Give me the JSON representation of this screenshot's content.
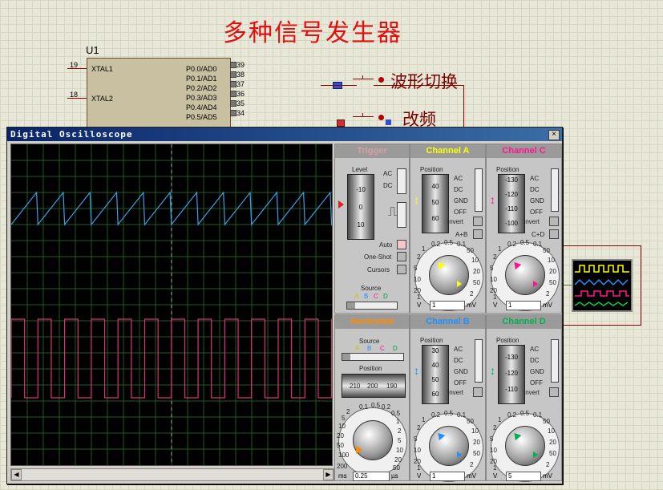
{
  "title": "多种信号发生器",
  "schematic": {
    "chip_ref": "U1",
    "pins_left": [
      {
        "num": "19",
        "name": "XTAL1"
      },
      {
        "num": "18",
        "name": "XTAL2"
      }
    ],
    "pins_right": [
      {
        "name": "P0.0/AD0",
        "num": "39"
      },
      {
        "name": "P0.1/AD1",
        "num": "38"
      },
      {
        "name": "P0.2/AD2",
        "num": "37"
      },
      {
        "name": "P0.3/AD3",
        "num": "36"
      },
      {
        "name": "P0.4/AD4",
        "num": "35"
      },
      {
        "name": "P0.5/AD5",
        "num": "34"
      }
    ],
    "button1_label": "波形切换",
    "button2_label": "改频"
  },
  "window": {
    "title": "Digital Oscilloscope",
    "close": "×"
  },
  "trigger": {
    "header": "Trigger",
    "level_label": "Level",
    "drum": [
      "-10",
      "0",
      "10"
    ],
    "ac": "AC",
    "dc": "DC",
    "auto": "Auto",
    "one_shot": "One-Shot",
    "cursors": "Cursors",
    "source_label": "Source",
    "sources": [
      "A",
      "B",
      "C",
      "D"
    ]
  },
  "channel_a": {
    "header": "Channel A",
    "position_label": "Position",
    "drum": [
      "40",
      "50",
      "60"
    ],
    "modes": [
      "AC",
      "DC",
      "GND",
      "OFF"
    ],
    "invert": "Invert",
    "combine": "A+B",
    "scale_left": [
      "1",
      "2",
      "5",
      "10",
      "20"
    ],
    "scale_right": [
      "10",
      "20",
      "50",
      "1",
      "2"
    ],
    "scale_top": [
      "0.2",
      "0.5"
    ],
    "scale_bot": [
      "0.1",
      "50"
    ],
    "unit_left": "V",
    "value": "1",
    "unit_right": "mV",
    "color": "#ffff00"
  },
  "channel_b": {
    "header": "Channel B",
    "position_label": "Position",
    "drum": [
      "30",
      "40",
      "50",
      "60"
    ],
    "modes": [
      "AC",
      "DC",
      "GND",
      "OFF"
    ],
    "invert": "Invert",
    "scale_left": [
      "1",
      "2",
      "5",
      "10",
      "20"
    ],
    "scale_right": [
      "10",
      "20",
      "50",
      "1",
      "2"
    ],
    "scale_top": [
      "0.2",
      "0.5"
    ],
    "scale_bot": [
      "0.1",
      "50"
    ],
    "unit_left": "V",
    "value": "1",
    "unit_right": "mV",
    "color": "#1e90ff"
  },
  "channel_c": {
    "header": "Channel C",
    "position_label": "Position",
    "drum": [
      "-130",
      "-120",
      "-110",
      "-100"
    ],
    "modes": [
      "AC",
      "DC",
      "GND",
      "OFF"
    ],
    "invert": "Invert",
    "combine": "C+D",
    "scale_left": [
      "1",
      "2",
      "5",
      "10",
      "20"
    ],
    "scale_right": [
      "10",
      "20",
      "50",
      "1",
      "2"
    ],
    "scale_top": [
      "0.2",
      "0.5"
    ],
    "scale_bot": [
      "0.1",
      "50"
    ],
    "unit_left": "V",
    "value": "1",
    "unit_right": "mV",
    "color": "#ff1493"
  },
  "channel_d": {
    "header": "Channel D",
    "position_label": "Position",
    "drum": [
      "-130",
      "-120",
      "-110"
    ],
    "modes": [
      "AC",
      "DC",
      "GND",
      "OFF"
    ],
    "invert": "Invert",
    "scale_left": [
      "1",
      "2",
      "5",
      "10",
      "20"
    ],
    "scale_right": [
      "10",
      "20",
      "50",
      "1",
      "2"
    ],
    "scale_top": [
      "0.2",
      "0.5"
    ],
    "scale_bot": [
      "0.1",
      "50"
    ],
    "unit_left": "V",
    "value": "5",
    "unit_right": "mV",
    "color": "#00b050"
  },
  "horizontal": {
    "header": "Horizontal",
    "source_label": "Source",
    "sources": [
      "A",
      "B",
      "C",
      "D"
    ],
    "position_label": "Position",
    "drum": [
      "210",
      "200",
      "190"
    ],
    "scale_left": [
      "1",
      "2",
      "5",
      "10",
      "20",
      "50",
      "100",
      "200"
    ],
    "scale_right": [
      "0.2",
      "0.5",
      "1",
      "2",
      "5",
      "10",
      "20",
      "50"
    ],
    "scale_top": [
      "0.1",
      "0.5",
      "0.2"
    ],
    "unit_left": "ms",
    "value": "0.25",
    "unit_right": "µs",
    "color": "#ff8c00"
  },
  "scroll": {
    "left": "◀",
    "right": "▶"
  }
}
